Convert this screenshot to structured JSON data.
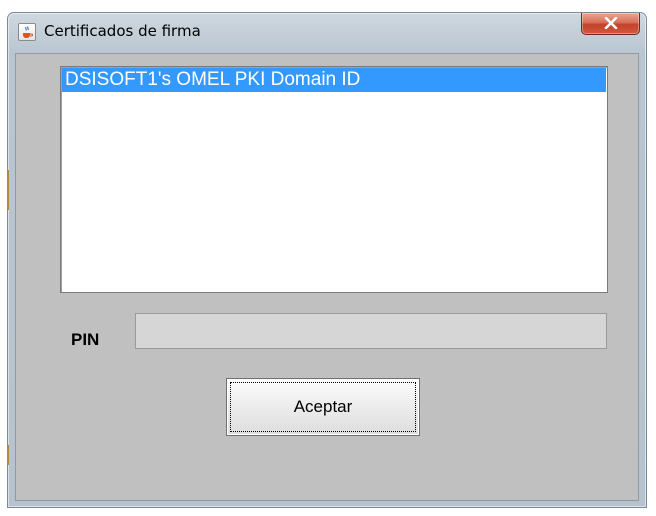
{
  "window": {
    "title": "Certificados de firma",
    "title_icon": "java-cup-icon",
    "close_icon": "close-icon"
  },
  "certificates": {
    "items": [
      "DSISOFT1's OMEL PKI Domain ID"
    ],
    "selected_index": 0
  },
  "pin": {
    "label": "PIN",
    "value": ""
  },
  "buttons": {
    "accept_label": "Aceptar"
  },
  "colors": {
    "selection": "#3399ff",
    "close_button": "#c4412b",
    "dialog_background": "#c0c0c0"
  }
}
